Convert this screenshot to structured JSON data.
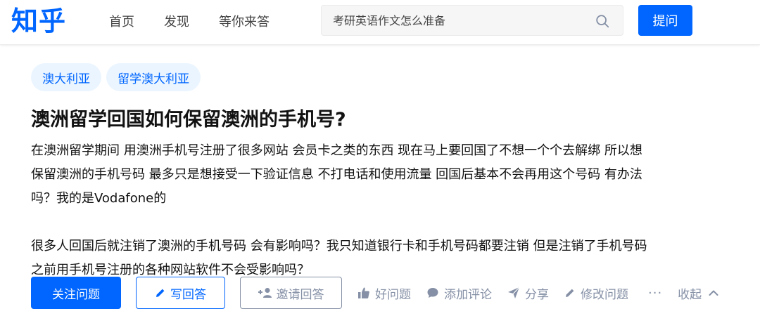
{
  "header": {
    "logo": "知乎",
    "nav": [
      "首页",
      "发现",
      "等你来答"
    ],
    "search": {
      "placeholder": "考研英语作文怎么准备",
      "value": ""
    },
    "ask_label": "提问"
  },
  "question": {
    "topics": [
      "澳大利亚",
      "留学澳大利亚"
    ],
    "title": "澳洲留学回国如何保留澳洲的手机号?",
    "paragraphs": [
      "在澳洲留学期间 用澳洲手机号注册了很多网站 会员卡之类的东西 现在马上要回国了不想一个个去解绑 所以想保留澳洲的手机号码 最多只是想接受一下验证信息 不打电话和使用流量 回国后基本不会再用这个号码 有办法吗？我的是Vodafone的",
      "很多人回国后就注销了澳洲的手机号码 会有影响吗？我只知道银行卡和手机号码都要注销 但是注销了手机号码 之前用手机号注册的各种网站软件不会受影响吗？"
    ]
  },
  "actions": {
    "follow": "关注问题",
    "write": "写回答",
    "invite": "邀请回答",
    "good": "好问题",
    "comment": "添加评论",
    "share": "分享",
    "edit": "修改问题",
    "more": "···",
    "collapse": "收起"
  },
  "colors": {
    "brand": "#0066ff",
    "muted": "#8590a6",
    "topic_bg": "#ebf5ff"
  }
}
